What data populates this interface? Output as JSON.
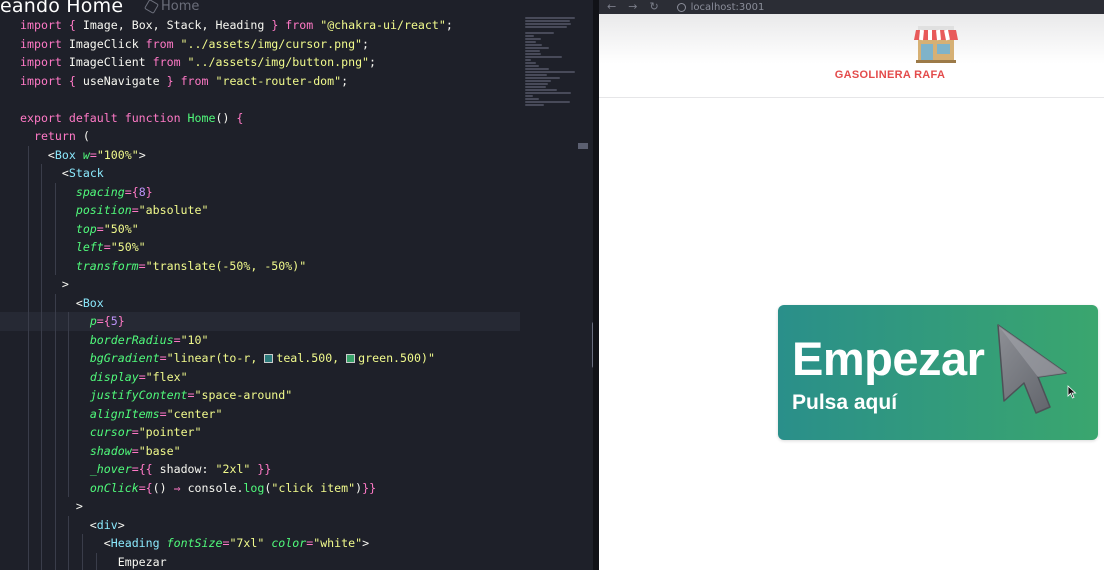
{
  "overlay": {
    "caption": "eando Home"
  },
  "editor": {
    "tab_label": "Home",
    "lines": [
      [
        [
          "kw",
          "import"
        ],
        [
          "pun",
          " "
        ],
        [
          "br",
          "{"
        ],
        [
          "id",
          " Image"
        ],
        [
          "pun",
          ","
        ],
        [
          "id",
          " Box"
        ],
        [
          "pun",
          ","
        ],
        [
          "id",
          " Stack"
        ],
        [
          "pun",
          ","
        ],
        [
          "id",
          " Heading"
        ],
        [
          "pun",
          " "
        ],
        [
          "br",
          "}"
        ],
        [
          "kw",
          " from"
        ],
        [
          "str",
          " \"@chakra-ui/react\""
        ],
        [
          "pun",
          ";"
        ]
      ],
      [
        [
          "kw",
          "import"
        ],
        [
          "id",
          " ImageClick"
        ],
        [
          "kw",
          " from"
        ],
        [
          "str",
          " \"../assets/img/cursor.png\""
        ],
        [
          "pun",
          ";"
        ]
      ],
      [
        [
          "kw",
          "import"
        ],
        [
          "id",
          " ImageClient"
        ],
        [
          "kw",
          " from"
        ],
        [
          "str",
          " \"../assets/img/button.png\""
        ],
        [
          "pun",
          ";"
        ]
      ],
      [
        [
          "kw",
          "import"
        ],
        [
          "pun",
          " "
        ],
        [
          "br",
          "{"
        ],
        [
          "id",
          " useNavigate"
        ],
        [
          "pun",
          " "
        ],
        [
          "br",
          "}"
        ],
        [
          "kw",
          " from"
        ],
        [
          "str",
          " \"react-router-dom\""
        ],
        [
          "pun",
          ";"
        ]
      ],
      [],
      [
        [
          "kw",
          "export"
        ],
        [
          "kw",
          " default"
        ],
        [
          "kw",
          " function"
        ],
        [
          "fn",
          " Home"
        ],
        [
          "pun",
          "() "
        ],
        [
          "br",
          "{"
        ]
      ],
      [
        [
          "pun",
          "  "
        ],
        [
          "kw",
          "return"
        ],
        [
          "pun",
          " ("
        ]
      ],
      [
        [
          "pun",
          "    <"
        ],
        [
          "comp",
          "Box"
        ],
        [
          "pun",
          " "
        ],
        [
          "attr",
          "w"
        ],
        [
          "op",
          "="
        ],
        [
          "str",
          "\"100%\""
        ],
        [
          "pun",
          ">"
        ]
      ],
      [
        [
          "pun",
          "      <"
        ],
        [
          "comp",
          "Stack"
        ]
      ],
      [
        [
          "pun",
          "        "
        ],
        [
          "attr",
          "spacing"
        ],
        [
          "op",
          "="
        ],
        [
          "br",
          "{"
        ],
        [
          "num",
          "8"
        ],
        [
          "br",
          "}"
        ]
      ],
      [
        [
          "pun",
          "        "
        ],
        [
          "attr",
          "position"
        ],
        [
          "op",
          "="
        ],
        [
          "str",
          "\"absolute\""
        ]
      ],
      [
        [
          "pun",
          "        "
        ],
        [
          "attr",
          "top"
        ],
        [
          "op",
          "="
        ],
        [
          "str",
          "\"50%\""
        ]
      ],
      [
        [
          "pun",
          "        "
        ],
        [
          "attr",
          "left"
        ],
        [
          "op",
          "="
        ],
        [
          "str",
          "\"50%\""
        ]
      ],
      [
        [
          "pun",
          "        "
        ],
        [
          "attr",
          "transform"
        ],
        [
          "op",
          "="
        ],
        [
          "str",
          "\"translate(-50%, -50%)\""
        ]
      ],
      [
        [
          "pun",
          "      >"
        ]
      ],
      [
        [
          "pun",
          "        <"
        ],
        [
          "comp",
          "Box"
        ]
      ],
      [
        [
          "pun",
          "          "
        ],
        [
          "attr",
          "p"
        ],
        [
          "op",
          "="
        ],
        [
          "br",
          "{"
        ],
        [
          "num",
          "5"
        ],
        [
          "br",
          "}"
        ]
      ],
      [
        [
          "pun",
          "          "
        ],
        [
          "attr",
          "borderRadius"
        ],
        [
          "op",
          "="
        ],
        [
          "str",
          "\"10\""
        ]
      ],
      [
        [
          "pun",
          "          "
        ],
        [
          "attr",
          "bgGradient"
        ],
        [
          "op",
          "="
        ],
        [
          "str",
          "\"linear(to-r, "
        ],
        [
          "sqteal",
          ""
        ],
        [
          "str",
          "teal.500, "
        ],
        [
          "sqgreen",
          ""
        ],
        [
          "str",
          "green.500)\""
        ]
      ],
      [
        [
          "pun",
          "          "
        ],
        [
          "attr",
          "display"
        ],
        [
          "op",
          "="
        ],
        [
          "str",
          "\"flex\""
        ]
      ],
      [
        [
          "pun",
          "          "
        ],
        [
          "attr",
          "justifyContent"
        ],
        [
          "op",
          "="
        ],
        [
          "str",
          "\"space-around\""
        ]
      ],
      [
        [
          "pun",
          "          "
        ],
        [
          "attr",
          "alignItems"
        ],
        [
          "op",
          "="
        ],
        [
          "str",
          "\"center\""
        ]
      ],
      [
        [
          "pun",
          "          "
        ],
        [
          "attr",
          "cursor"
        ],
        [
          "op",
          "="
        ],
        [
          "str",
          "\"pointer\""
        ]
      ],
      [
        [
          "pun",
          "          "
        ],
        [
          "attr",
          "shadow"
        ],
        [
          "op",
          "="
        ],
        [
          "str",
          "\"base\""
        ]
      ],
      [
        [
          "pun",
          "          "
        ],
        [
          "attr",
          "_hover"
        ],
        [
          "op",
          "="
        ],
        [
          "br",
          "{{"
        ],
        [
          "id",
          " shadow"
        ],
        [
          "pun",
          ": "
        ],
        [
          "str",
          "\"2xl\""
        ],
        [
          "pun",
          " "
        ],
        [
          "br",
          "}}"
        ]
      ],
      [
        [
          "pun",
          "          "
        ],
        [
          "attr",
          "onClick"
        ],
        [
          "op",
          "="
        ],
        [
          "br",
          "{"
        ],
        [
          "pun",
          "() "
        ],
        [
          "op",
          "⇒"
        ],
        [
          "id",
          " console"
        ],
        [
          "pun",
          "."
        ],
        [
          "fn",
          "log"
        ],
        [
          "pun",
          "("
        ],
        [
          "str",
          "\"click item\""
        ],
        [
          "pun",
          ")"
        ],
        [
          "br",
          "}"
        ],
        [
          "br",
          "}"
        ]
      ],
      [
        [
          "pun",
          "        >"
        ]
      ],
      [
        [
          "pun",
          "          <"
        ],
        [
          "comp",
          "div"
        ],
        [
          "pun",
          ">"
        ]
      ],
      [
        [
          "pun",
          "            <"
        ],
        [
          "comp",
          "Heading"
        ],
        [
          "pun",
          " "
        ],
        [
          "attr",
          "fontSize"
        ],
        [
          "op",
          "="
        ],
        [
          "str",
          "\"7xl\""
        ],
        [
          "pun",
          " "
        ],
        [
          "attr",
          "color"
        ],
        [
          "op",
          "="
        ],
        [
          "str",
          "\"white\""
        ],
        [
          "pun",
          ">"
        ]
      ],
      [
        [
          "pun",
          "              "
        ],
        [
          "id",
          "Empezar"
        ]
      ]
    ],
    "current_line": 16
  },
  "browser": {
    "url": "localhost:3001",
    "nav": {
      "back": "←",
      "forward": "→",
      "reload": "↻"
    }
  },
  "site": {
    "title": "GASOLINERA RAFA",
    "button": {
      "title": "Empezar",
      "subtitle": "Pulsa aquí"
    }
  },
  "colors": {
    "button_gradient_start": "#2a8f8a",
    "button_gradient_end": "#3aa66e",
    "title_red": "#e34b4b"
  }
}
